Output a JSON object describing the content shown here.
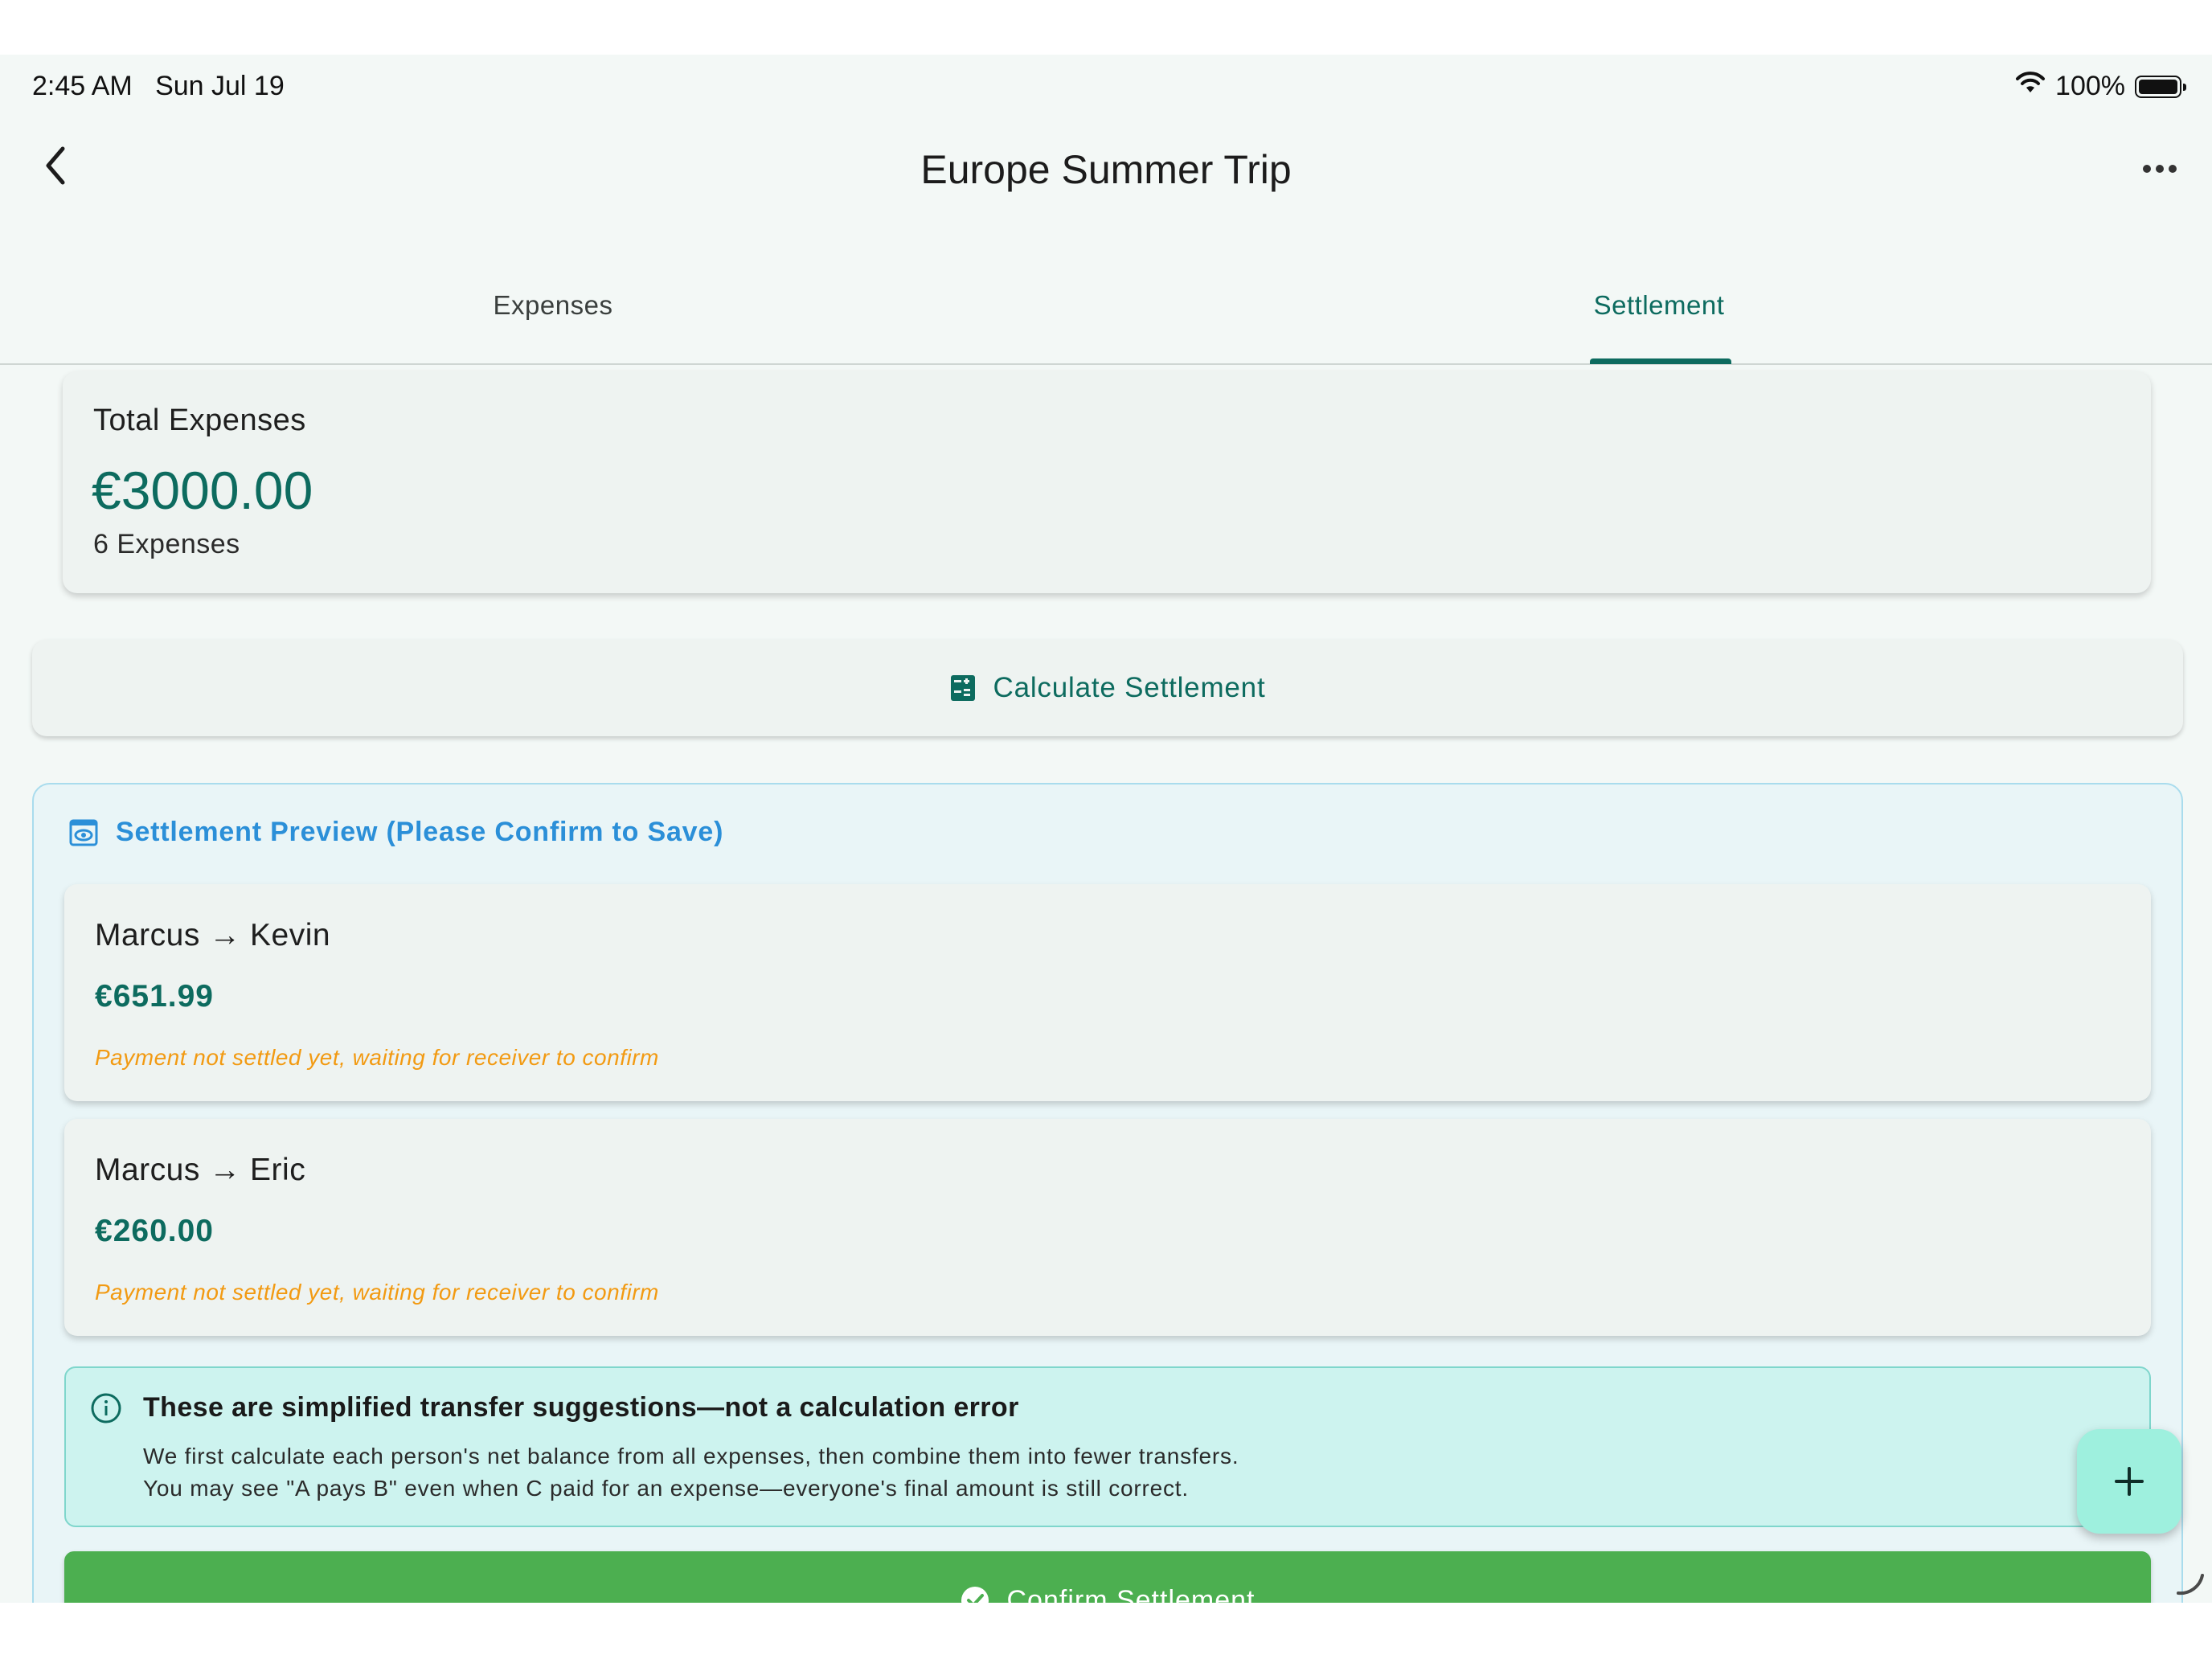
{
  "status_bar": {
    "time": "2:45 AM   Sun Jul 19",
    "battery": "100%"
  },
  "header": {
    "title": "Europe Summer Trip"
  },
  "tabs": [
    {
      "label": "Expenses",
      "active": false
    },
    {
      "label": "Settlement",
      "active": true
    }
  ],
  "summary": {
    "label": "Total Expenses",
    "amount": "€3000.00",
    "count": "6 Expenses"
  },
  "calculate_button": {
    "label": "Calculate Settlement"
  },
  "preview": {
    "title": "Settlement Preview (Please Confirm to Save)",
    "transfers": [
      {
        "names": "Marcus → Kevin",
        "amount": "€651.99",
        "status": "Payment not settled yet, waiting for receiver to confirm"
      },
      {
        "names": "Marcus → Eric",
        "amount": "€260.00",
        "status": "Payment not settled yet, waiting for receiver to confirm"
      }
    ],
    "info": {
      "title": "These are simplified transfer suggestions—not a calculation error",
      "line1": "We first calculate each person's net balance from all expenses, then combine them into fewer transfers.",
      "line2": "You may see \"A pays B\" even when C paid for an expense—everyone's final amount is still correct."
    },
    "confirm_label": "Confirm Settlement"
  },
  "colors": {
    "primary": "#0d6b5f",
    "preview_accent": "#2b8fd8",
    "warning": "#f29a12",
    "confirm": "#4caf50",
    "fab": "#9ef0de"
  }
}
